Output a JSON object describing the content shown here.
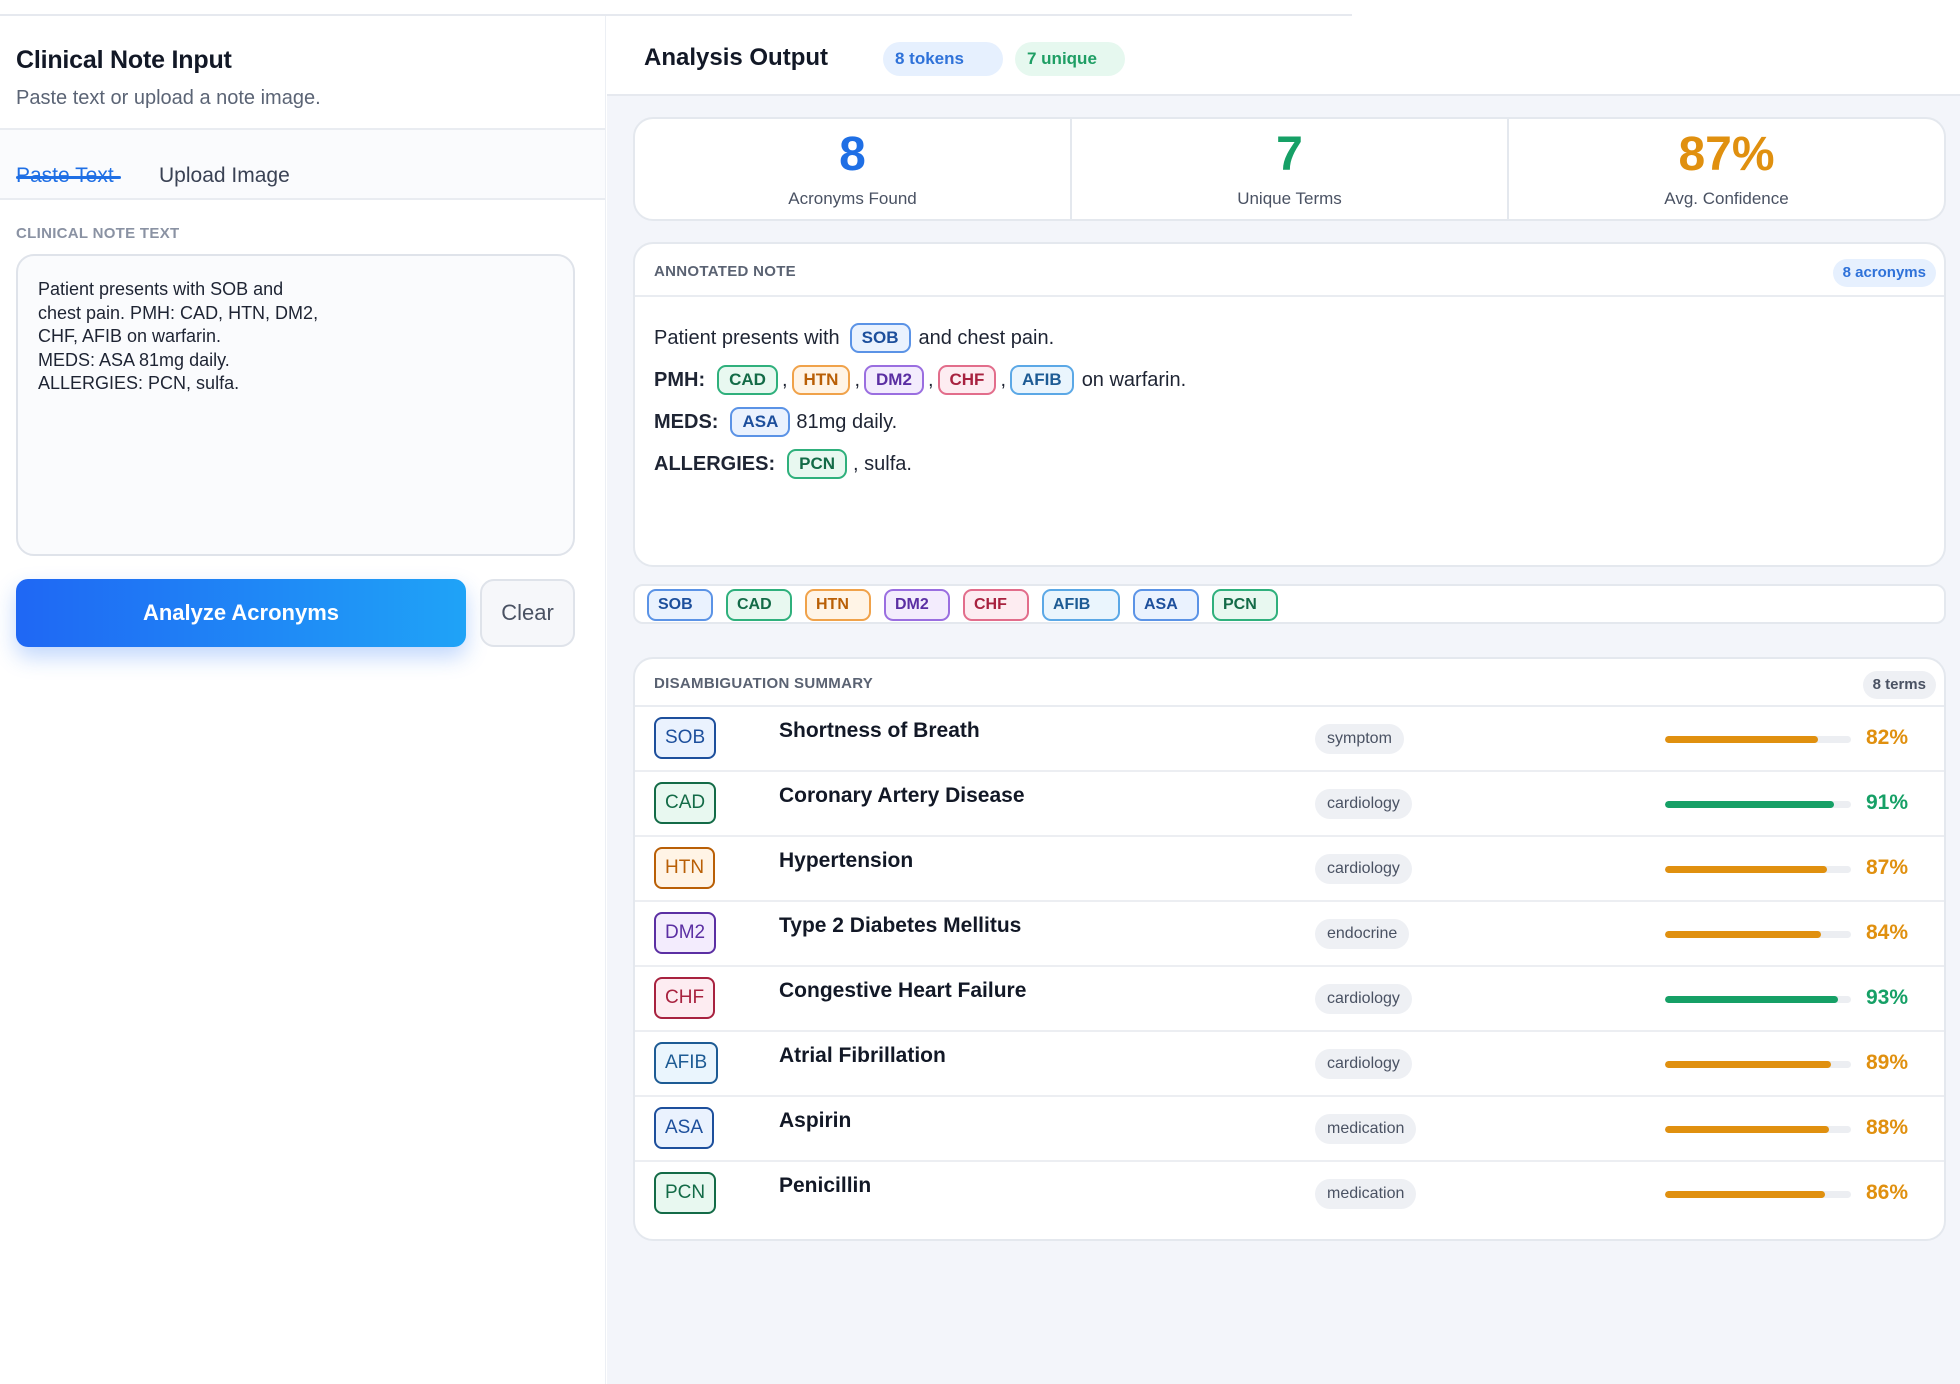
{
  "left": {
    "title": "Clinical Note Input",
    "subtitle": "Paste text or upload a note image.",
    "tabs": [
      {
        "label": "Paste Text",
        "active": true
      },
      {
        "label": "Upload Image",
        "active": false
      }
    ],
    "field_label": "CLINICAL NOTE TEXT",
    "note_text": "Patient presents with SOB and\nchest pain. PMH: CAD, HTN, DM2,\nCHF, AFIB on warfarin.\nMEDS: ASA 81mg daily.\nALLERGIES: PCN, sulfa.",
    "analyze_label": "Analyze Acronyms",
    "clear_label": "Clear"
  },
  "right": {
    "title": "Analysis Output",
    "tokens_pill": "8 tokens",
    "unique_pill": "7 unique",
    "stats": [
      {
        "value": "8",
        "label": "Acronyms Found",
        "color": "#1f6fe5"
      },
      {
        "value": "7",
        "label": "Unique Terms",
        "color": "#16a066"
      },
      {
        "value": "87%",
        "label": "Avg. Confidence",
        "color": "#e0900f"
      }
    ],
    "annotated": {
      "title": "ANNOTATED NOTE",
      "count_pill": "8 acronyms",
      "line1_pre": "Patient presents with",
      "line1_chip": "SOB",
      "line1_post": "and chest pain.",
      "line2_label": "PMH:",
      "line2_chips": [
        "CAD",
        "HTN",
        "DM2",
        "CHF",
        "AFIB"
      ],
      "line2_post": "on warfarin.",
      "line3_label": "MEDS:",
      "line3_chip": "ASA",
      "line3_post": "81mg daily.",
      "line4_label": "ALLERGIES:",
      "line4_chip": "PCN",
      "line4_post": ", sulfa."
    },
    "chipbar": [
      "SOB",
      "CAD",
      "HTN",
      "DM2",
      "CHF",
      "AFIB",
      "ASA",
      "PCN"
    ],
    "summary": {
      "title": "DISAMBIGUATION SUMMARY",
      "count_pill": "8 terms",
      "rows": [
        {
          "acronym": "SOB",
          "term": "Shortness of Breath",
          "category": "symptom",
          "confidence": 82,
          "pct": "82%"
        },
        {
          "acronym": "CAD",
          "term": "Coronary Artery Disease",
          "category": "cardiology",
          "confidence": 91,
          "pct": "91%"
        },
        {
          "acronym": "HTN",
          "term": "Hypertension",
          "category": "cardiology",
          "confidence": 87,
          "pct": "87%"
        },
        {
          "acronym": "DM2",
          "term": "Type 2 Diabetes Mellitus",
          "category": "endocrine",
          "confidence": 84,
          "pct": "84%"
        },
        {
          "acronym": "CHF",
          "term": "Congestive Heart Failure",
          "category": "cardiology",
          "confidence": 93,
          "pct": "93%"
        },
        {
          "acronym": "AFIB",
          "term": "Atrial Fibrillation",
          "category": "cardiology",
          "confidence": 89,
          "pct": "89%"
        },
        {
          "acronym": "ASA",
          "term": "Aspirin",
          "category": "medication",
          "confidence": 88,
          "pct": "88%"
        },
        {
          "acronym": "PCN",
          "term": "Penicillin",
          "category": "medication",
          "confidence": 86,
          "pct": "86%"
        }
      ]
    },
    "colors": {
      "high_confidence": "#16a066",
      "mid_confidence": "#e0900f"
    }
  }
}
